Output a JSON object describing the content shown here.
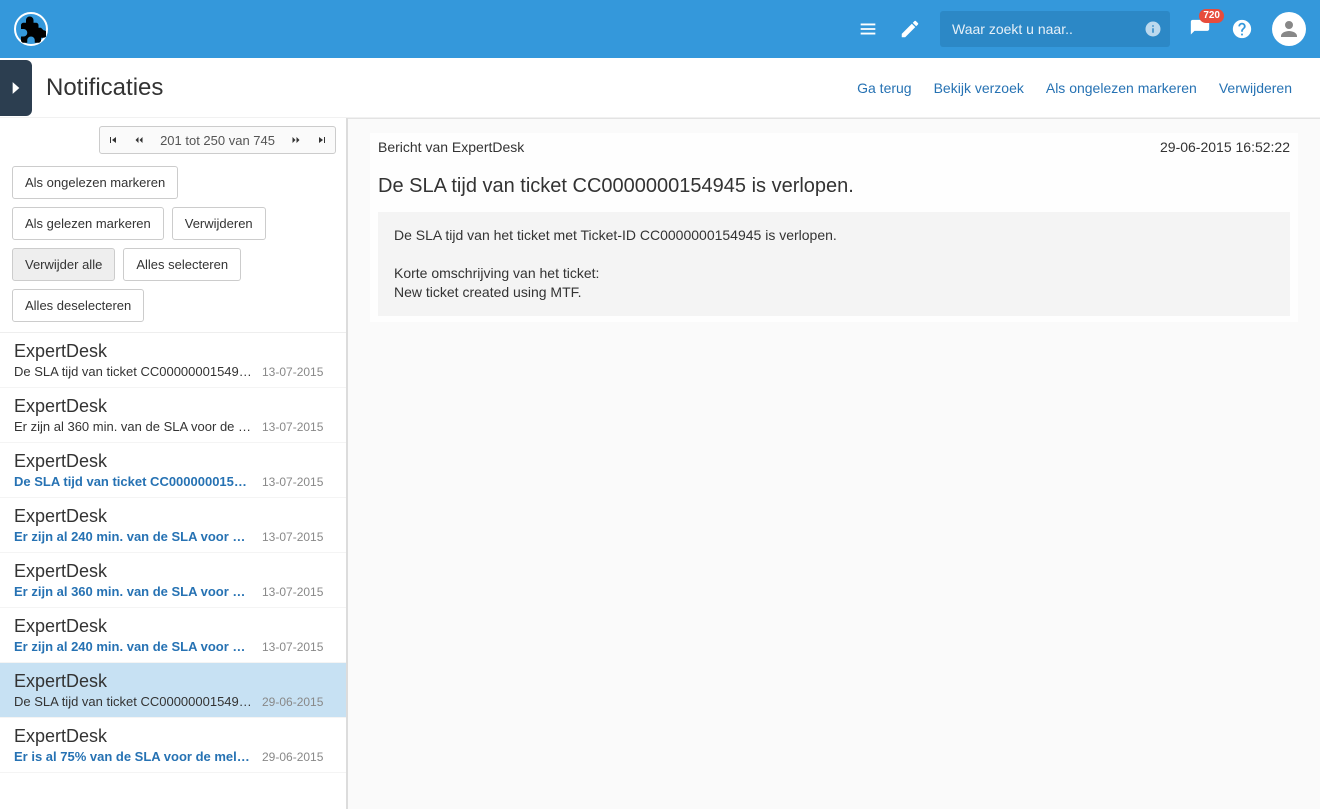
{
  "header": {
    "search_placeholder": "Waar zoekt u naar..",
    "notification_badge": "720"
  },
  "subheader": {
    "title": "Notificaties",
    "links": {
      "back": "Ga terug",
      "view_request": "Bekijk verzoek",
      "mark_unread": "Als ongelezen markeren",
      "delete": "Verwijderen"
    }
  },
  "sidebar": {
    "pager": {
      "text": "201 tot 250 van 745"
    },
    "buttons": {
      "mark_unread": "Als ongelezen markeren",
      "mark_read": "Als gelezen markeren",
      "delete": "Verwijderen",
      "delete_all": "Verwijder alle",
      "select_all": "Alles selecteren",
      "deselect_all": "Alles deselecteren"
    },
    "items": [
      {
        "sender": "ExpertDesk",
        "preview": "De SLA tijd van ticket CC00000001549…",
        "date": "13-07-2015",
        "unread": false,
        "selected": false
      },
      {
        "sender": "ExpertDesk",
        "preview": "Er zijn al 360 min. van de SLA voor de …",
        "date": "13-07-2015",
        "unread": false,
        "selected": false
      },
      {
        "sender": "ExpertDesk",
        "preview": "De SLA tijd van ticket CC0000000154…",
        "date": "13-07-2015",
        "unread": true,
        "selected": false
      },
      {
        "sender": "ExpertDesk",
        "preview": "Er zijn al 240 min. van de SLA voor …",
        "date": "13-07-2015",
        "unread": true,
        "selected": false
      },
      {
        "sender": "ExpertDesk",
        "preview": "Er zijn al 360 min. van de SLA voor …",
        "date": "13-07-2015",
        "unread": true,
        "selected": false
      },
      {
        "sender": "ExpertDesk",
        "preview": "Er zijn al 240 min. van de SLA voor …",
        "date": "13-07-2015",
        "unread": true,
        "selected": false
      },
      {
        "sender": "ExpertDesk",
        "preview": "De SLA tijd van ticket CC00000001549…",
        "date": "29-06-2015",
        "unread": false,
        "selected": true
      },
      {
        "sender": "ExpertDesk",
        "preview": "Er is al 75% van de SLA voor de mel…",
        "date": "29-06-2015",
        "unread": true,
        "selected": false
      }
    ]
  },
  "detail": {
    "from_label": "Bericht van ExpertDesk",
    "datetime": "29-06-2015 16:52:22",
    "subject": "De SLA tijd van ticket CC0000000154945 is verlopen.",
    "body": "De SLA tijd van het ticket met Ticket-ID CC0000000154945 is verlopen.\n\nKorte omschrijving van het ticket:\nNew ticket created using MTF."
  }
}
